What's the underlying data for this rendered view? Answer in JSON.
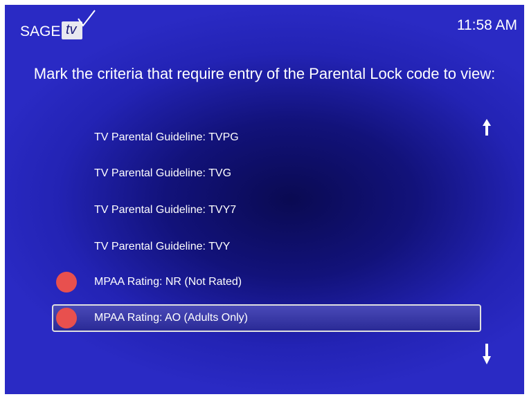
{
  "header": {
    "logo_text": "SAGE",
    "logo_badge": "tv",
    "clock": "11:58 AM"
  },
  "prompt": "Mark the criteria that require entry of the Parental Lock code to view:",
  "items": [
    {
      "label": "TV Parental Guideline: TVPG",
      "marked": false,
      "selected": false
    },
    {
      "label": "TV Parental Guideline: TVG",
      "marked": false,
      "selected": false
    },
    {
      "label": "TV Parental Guideline: TVY7",
      "marked": false,
      "selected": false
    },
    {
      "label": "TV Parental Guideline: TVY",
      "marked": false,
      "selected": false
    },
    {
      "label": "MPAA Rating: NR (Not Rated)",
      "marked": true,
      "selected": false
    },
    {
      "label": "MPAA Rating: AO (Adults Only)",
      "marked": true,
      "selected": true
    }
  ],
  "colors": {
    "background": "#2323b4",
    "marker": "#e8504e",
    "text": "#ffffff"
  },
  "icons": {
    "scroll_up": "up-arrow-icon",
    "scroll_down": "down-arrow-icon",
    "marked": "red-dot-icon"
  }
}
